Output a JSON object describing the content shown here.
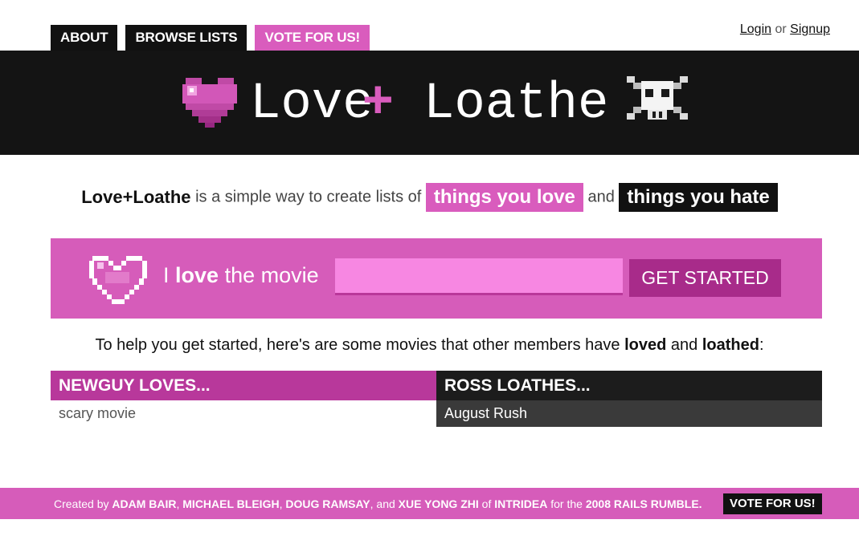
{
  "nav": {
    "about": "ABOUT",
    "browse": "BROWSE LISTS",
    "vote": "VOTE FOR US!"
  },
  "auth": {
    "login": "Login",
    "or": "or",
    "signup": "Signup"
  },
  "logo": {
    "love": "Love",
    "plus": "+",
    "loathe": "Loathe"
  },
  "tagline": {
    "brand": "Love+Loathe",
    "text": "is a simple way to create lists of",
    "love_pill": "things you love",
    "and": "and",
    "hate_pill": "things you hate"
  },
  "form": {
    "prefix": "I",
    "verb": "love",
    "suffix": "the movie",
    "input_value": "",
    "button": "GET STARTED"
  },
  "helper": {
    "text1": "To help you get started, here's are some movies that other members have",
    "loved": "loved",
    "and": "and",
    "loathed": "loathed",
    "colon": ":"
  },
  "lists": {
    "left": {
      "title": "NEWGUY LOVES...",
      "item": "scary movie"
    },
    "right": {
      "title": "ROSS LOATHES...",
      "item": "August Rush"
    }
  },
  "footer": {
    "created": "Created by",
    "n1": "ADAM BAIR",
    "n2": "MICHAEL BLEIGH",
    "n3": "DOUG RAMSAY",
    "and": "and",
    "n4": "XUE YONG ZHI",
    "of": "of",
    "company": "INTRIDEA",
    "for": "for the",
    "event": "2008 RAILS RUMBLE.",
    "vote": "VOTE FOR US!"
  },
  "colors": {
    "pink": "#d95cbd",
    "dark_pink": "#b8389b",
    "black": "#141414"
  }
}
